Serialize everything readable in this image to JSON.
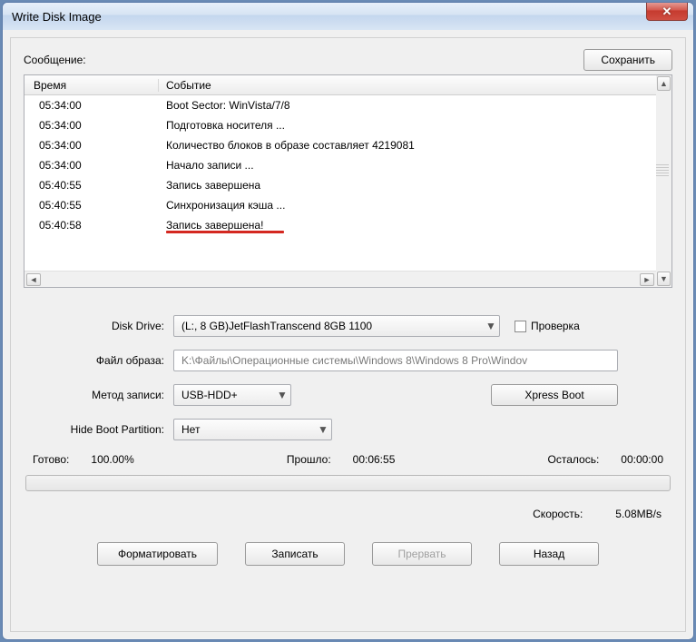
{
  "window": {
    "title": "Write Disk Image",
    "close_glyph": "✕"
  },
  "messages": {
    "label": "Сообщение:",
    "save_button": "Сохранить"
  },
  "log": {
    "header_time": "Время",
    "header_event": "Событие",
    "rows": [
      {
        "time": "05:34:00",
        "event": "Boot Sector: WinVista/7/8"
      },
      {
        "time": "05:34:00",
        "event": "Подготовка носителя ..."
      },
      {
        "time": "05:34:00",
        "event": "Количество блоков в образе составляет 4219081"
      },
      {
        "time": "05:34:00",
        "event": "Начало записи ..."
      },
      {
        "time": "05:40:55",
        "event": "Запись завершена"
      },
      {
        "time": "05:40:55",
        "event": "Синхронизация кэша ..."
      },
      {
        "time": "05:40:58",
        "event": "Запись завершена!"
      }
    ]
  },
  "form": {
    "disk_drive_label": "Disk Drive:",
    "disk_drive_value": "(L:, 8 GB)JetFlashTranscend 8GB   1100",
    "verify_label": "Проверка",
    "image_file_label": "Файл образа:",
    "image_file_value": "K:\\Файлы\\Операционные системы\\Windows 8\\Windows 8 Pro\\Windov",
    "write_method_label": "Метод записи:",
    "write_method_value": "USB-HDD+",
    "xpress_boot_button": "Xpress Boot",
    "hide_boot_label": "Hide Boot Partition:",
    "hide_boot_value": "Нет"
  },
  "status": {
    "ready_label": "Готово:",
    "ready_value": "100.00%",
    "elapsed_label": "Прошло:",
    "elapsed_value": "00:06:55",
    "remain_label": "Осталось:",
    "remain_value": "00:00:00",
    "speed_label": "Скорость:",
    "speed_value": "5.08MB/s"
  },
  "buttons": {
    "format": "Форматировать",
    "write": "Записать",
    "abort": "Прервать",
    "back": "Назад"
  }
}
